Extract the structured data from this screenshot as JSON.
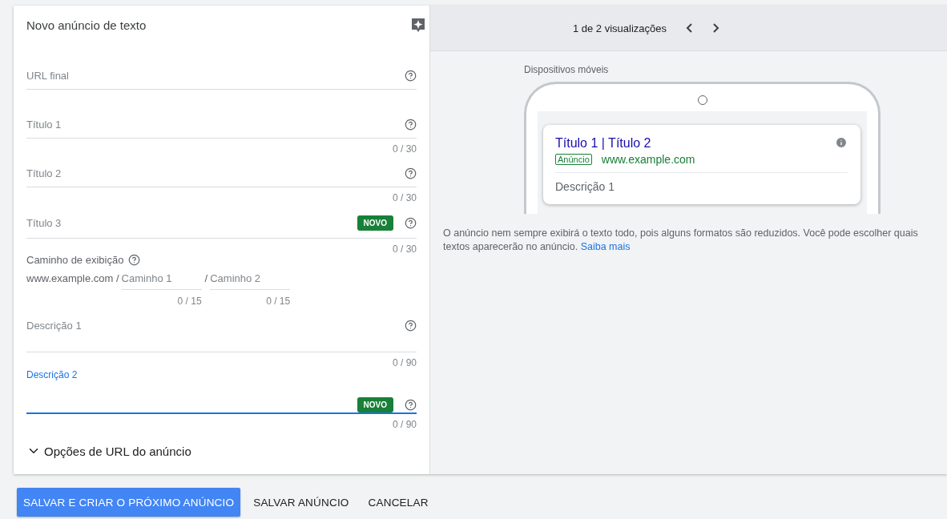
{
  "form": {
    "title": "Novo anúncio de texto",
    "fields": [
      {
        "kind": "single",
        "label": "URL final",
        "focused": false
      },
      {
        "kind": "single",
        "label": "Título 1",
        "counter": "0 / 30",
        "focused": false
      },
      {
        "kind": "single",
        "label": "Título 2",
        "counter": "0 / 30",
        "focused": false
      },
      {
        "kind": "single",
        "label": "Título 3",
        "badge": "NOVO",
        "counter": "0 / 30",
        "focused": false
      },
      {
        "kind": "path",
        "label": "Caminho de exibição",
        "domain": "www.example.com /",
        "paths": [
          {
            "placeholder": "Caminho 1",
            "counter": "0 / 15"
          },
          {
            "separator": "/",
            "placeholder": "Caminho 2",
            "counter": "0 / 15"
          }
        ]
      },
      {
        "kind": "multi",
        "label": "Descrição 1",
        "counter": "0 / 90",
        "focused": false
      },
      {
        "kind": "multi",
        "label": "Descrição 2",
        "badge": "NOVO",
        "counter": "0 / 90",
        "focused": true
      }
    ],
    "expander": {
      "label": "Opções de URL do anúncio",
      "expanded": false
    }
  },
  "preview": {
    "pager": "1 de 2 visualizações",
    "device_label": "Dispositivos móveis",
    "ad": {
      "headline": "Título 1 | Título 2",
      "badge": "Anúncio",
      "url": "www.example.com",
      "description": "Descrição 1"
    },
    "note": "O anúncio nem sempre exibirá o texto todo, pois alguns formatos são reduzidos. Você pode escolher quais textos aparecerão no anúncio.",
    "note_link": "Saiba mais"
  },
  "buttons": [
    {
      "label": "SALVAR E CRIAR O PRÓXIMO ANÚNCIO",
      "kind": "primary"
    },
    {
      "label": "SALVAR ANÚNCIO",
      "kind": "text"
    },
    {
      "label": "CANCELAR",
      "kind": "text"
    }
  ]
}
